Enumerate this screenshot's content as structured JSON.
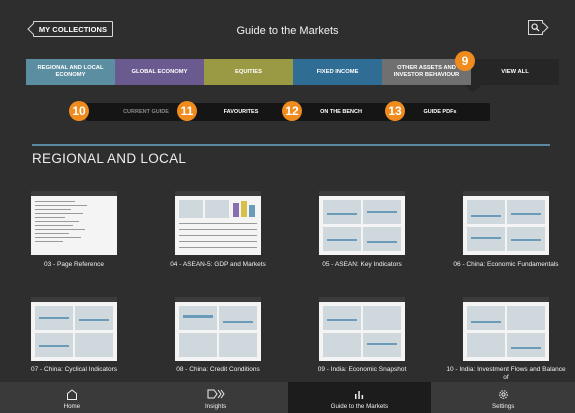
{
  "header": {
    "collections_label": "MY COLLECTIONS",
    "title": "Guide to the Markets",
    "search_icon": "search-icon"
  },
  "category_tabs": [
    {
      "label": "REGIONAL AND LOCAL ECONOMY",
      "color": "#5c8ea1"
    },
    {
      "label": "GLOBAL ECONOMY",
      "color": "#6a5a90"
    },
    {
      "label": "EQUITIES",
      "color": "#9a9a45"
    },
    {
      "label": "FIXED INCOME",
      "color": "#2f6d94"
    },
    {
      "label": "OTHER ASSETS AND INVESTOR BEHAVIOUR",
      "color": "#707070"
    },
    {
      "label": "VIEW ALL",
      "color": "#262626"
    }
  ],
  "badges": [
    "9",
    "10",
    "11",
    "12",
    "13"
  ],
  "sub_tabs": [
    {
      "label": "CURRENT GUIDE"
    },
    {
      "label": "FAVOURITES"
    },
    {
      "label": "ON THE BENCH"
    },
    {
      "label": "GUIDE PDFs"
    }
  ],
  "section": {
    "title": "REGIONAL AND LOCAL"
  },
  "items": [
    {
      "caption": "03 - Page Reference"
    },
    {
      "caption": "04 - ASEAN-5: GDP and Markets"
    },
    {
      "caption": "05 - ASEAN: Key Indicators"
    },
    {
      "caption": "06 - China: Economic Fundamentals"
    },
    {
      "caption": "07 - China: Cyclical Indicators"
    },
    {
      "caption": "08 - China: Credit Conditions"
    },
    {
      "caption": "09 - India: Economic Snapshot"
    },
    {
      "caption": "10 - India: Investment Flows and Balance of"
    }
  ],
  "bottom_nav": [
    {
      "label": "Home",
      "icon": "home-icon"
    },
    {
      "label": "Insights",
      "icon": "insights-icon"
    },
    {
      "label": "Guide to the Markets",
      "icon": "chart-icon"
    },
    {
      "label": "Settings",
      "icon": "gear-icon"
    }
  ],
  "colors": {
    "accent": "#f08b1e",
    "divider": "#5a88a0",
    "background": "#2e2e2e"
  }
}
